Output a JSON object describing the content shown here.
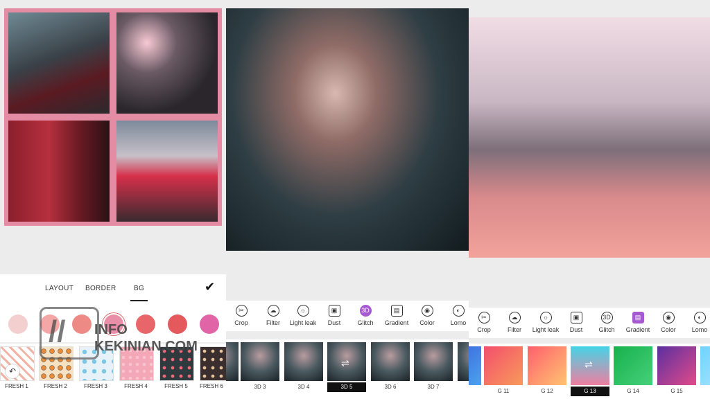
{
  "panel1": {
    "tabs": [
      "LAYOUT",
      "BORDER",
      "BG"
    ],
    "colors": [
      "#f4cfcf",
      "#f3a7a7",
      "#ee8a86",
      "#e88ea8",
      "#e8666a",
      "#e45a5c",
      "#e165a6"
    ],
    "patterns": [
      "FRESH 1",
      "FRESH 2",
      "FRESH 3",
      "FRESH 4",
      "FRESH 5",
      "FRESH 6"
    ]
  },
  "panel2": {
    "tools": [
      "Crop",
      "Filter",
      "Light leak",
      "Dust",
      "Glitch",
      "Gradient",
      "Color",
      "Lomo"
    ],
    "thumbs": [
      "3D 3",
      "3D 4",
      "3D 5",
      "3D 6",
      "3D 7"
    ]
  },
  "panel3": {
    "tools": [
      "Crop",
      "Filter",
      "Light leak",
      "Dust",
      "Glitch",
      "Gradient",
      "Color",
      "Lomo"
    ],
    "gradients": [
      "G 11",
      "G 12",
      "G 13",
      "G 14",
      "G 15"
    ]
  },
  "watermark": "INFO KEKINIAN.COM"
}
